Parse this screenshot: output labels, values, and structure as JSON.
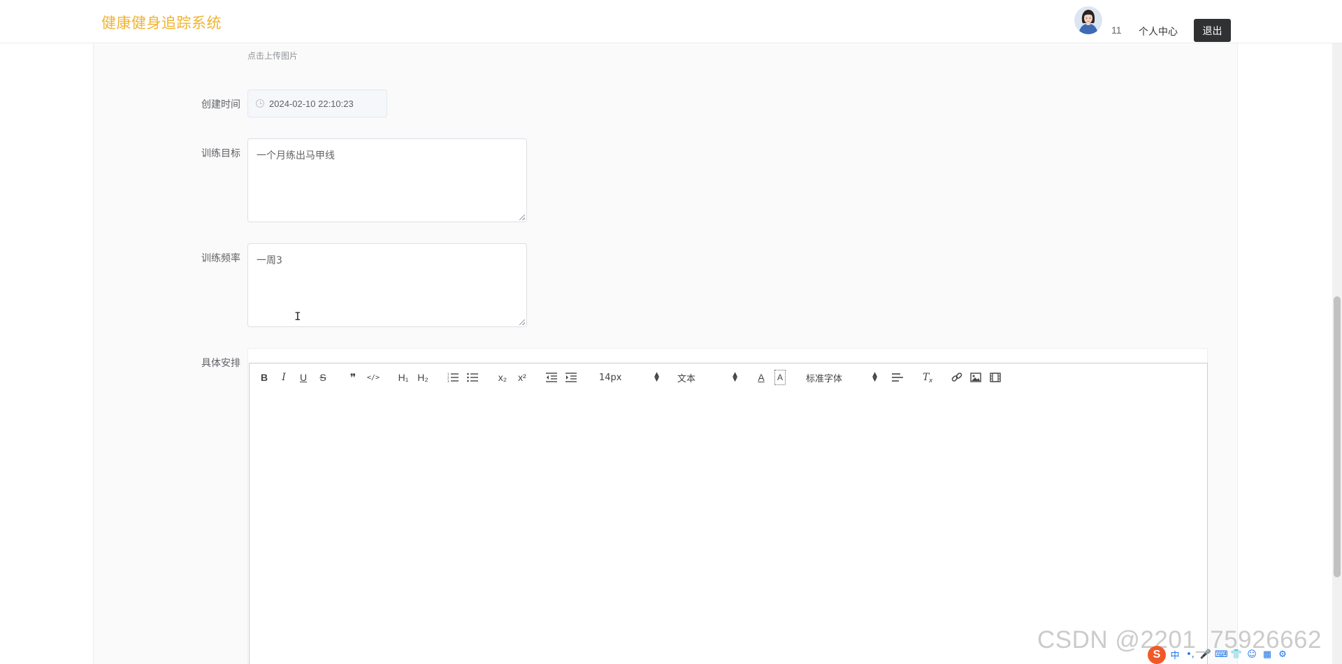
{
  "header": {
    "brand": "健康健身追踪系统",
    "user_count": "11",
    "user_center": "个人中心",
    "logout": "退出"
  },
  "form": {
    "upload_hint": "点击上传图片",
    "created_time": {
      "label": "创建时间",
      "value": "2024-02-10 22:10:23"
    },
    "training_goal": {
      "label": "训练目标",
      "value": "一个月练出马甲线"
    },
    "training_frequency": {
      "label": "训练频率",
      "value": "一周3"
    },
    "schedule": {
      "label": "具体安排"
    }
  },
  "editor": {
    "toolbar": {
      "bold": "B",
      "italic": "I",
      "underline": "U",
      "strike": "S",
      "blockquote": "❞",
      "code": "</>",
      "h1": "H₁",
      "h2": "H₂",
      "ordered_list": "ordered-list-icon",
      "bullet_list": "bullet-list-icon",
      "subscript": "x₂",
      "superscript": "x²",
      "outdent": "outdent-icon",
      "indent": "indent-icon",
      "size": "14px",
      "header": "文本",
      "color": "A",
      "background": "A",
      "font": "标准字体",
      "align": "align-icon",
      "clean": "Tx",
      "link": "link-icon",
      "image": "image-icon",
      "video": "video-icon"
    }
  },
  "watermark": "CSDN @2201_75926662",
  "colors": {
    "brand": "#f0b330",
    "logout_bg": "#303133",
    "panel_bg": "#fafafa"
  }
}
